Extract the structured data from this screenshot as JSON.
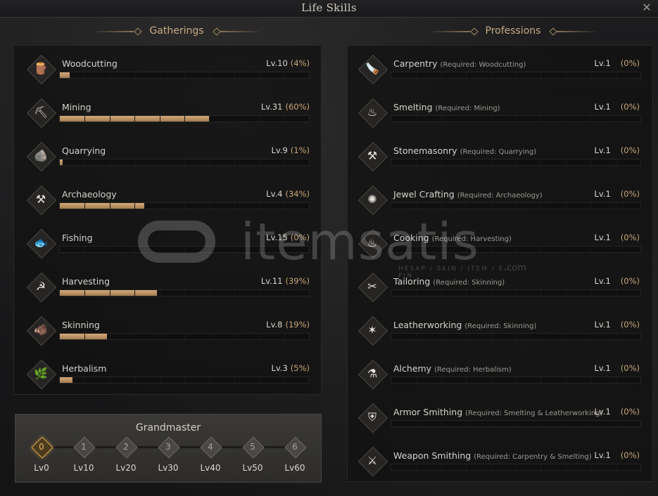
{
  "window": {
    "title": "Life Skills",
    "close_icon": "close-icon"
  },
  "gatherings": {
    "header": "Gatherings",
    "skills": [
      {
        "name": "Woodcutting",
        "level": "Lv.10",
        "percent": "(4%)",
        "progress": 0.04,
        "icon": "logs-icon",
        "glyph": "🪵"
      },
      {
        "name": "Mining",
        "level": "Lv.31",
        "percent": "(60%)",
        "progress": 0.6,
        "icon": "pickaxe-icon",
        "glyph": "⛏"
      },
      {
        "name": "Quarrying",
        "level": "Lv.9",
        "percent": "(1%)",
        "progress": 0.01,
        "icon": "stone-icon",
        "glyph": "🪨"
      },
      {
        "name": "Archaeology",
        "level": "Lv.4",
        "percent": "(34%)",
        "progress": 0.34,
        "icon": "shovel-icon",
        "glyph": "⚒"
      },
      {
        "name": "Fishing",
        "level": "Lv.15",
        "percent": "(0%)",
        "progress": 0.0,
        "icon": "fish-icon",
        "glyph": "🐟"
      },
      {
        "name": "Harvesting",
        "level": "Lv.11",
        "percent": "(39%)",
        "progress": 0.39,
        "icon": "sickle-icon",
        "glyph": "☭"
      },
      {
        "name": "Skinning",
        "level": "Lv.8",
        "percent": "(19%)",
        "progress": 0.19,
        "icon": "boar-icon",
        "glyph": "🐗"
      },
      {
        "name": "Herbalism",
        "level": "Lv.3",
        "percent": "(5%)",
        "progress": 0.05,
        "icon": "leaf-icon",
        "glyph": "🌿"
      }
    ]
  },
  "professions": {
    "header": "Professions",
    "skills": [
      {
        "name": "Carpentry",
        "req": "(Required: Woodcutting)",
        "level": "Lv.1",
        "percent": "(0%)",
        "icon": "saw-icon",
        "glyph": "🪚"
      },
      {
        "name": "Smelting",
        "req": "(Required: Mining)",
        "level": "Lv.1",
        "percent": "(0%)",
        "icon": "furnace-icon",
        "glyph": "♨"
      },
      {
        "name": "Stonemasonry",
        "req": "(Required: Quarrying)",
        "level": "Lv.1",
        "percent": "(0%)",
        "icon": "chisel-icon",
        "glyph": "⚒"
      },
      {
        "name": "Jewel Crafting",
        "req": "(Required: Archaeology)",
        "level": "Lv.1",
        "percent": "(0%)",
        "icon": "gem-icon",
        "glyph": "✺"
      },
      {
        "name": "Cooking",
        "req": "(Required: Harvesting)",
        "level": "Lv.1",
        "percent": "(0%)",
        "icon": "cauldron-icon",
        "glyph": "♨"
      },
      {
        "name": "Tailoring",
        "req": "(Required: Skinning)",
        "level": "Lv.1",
        "percent": "(0%)",
        "icon": "needle-icon",
        "glyph": "✂"
      },
      {
        "name": "Leatherworking",
        "req": "(Required: Skinning)",
        "level": "Lv.1",
        "percent": "(0%)",
        "icon": "hide-icon",
        "glyph": "✶"
      },
      {
        "name": "Alchemy",
        "req": "(Required: Herbalism)",
        "level": "Lv.1",
        "percent": "(0%)",
        "icon": "mortar-icon",
        "glyph": "⚗"
      },
      {
        "name": "Armor Smithing",
        "req": "(Required: Smelting & Leatherworking)",
        "level": "Lv.1",
        "percent": "(0%)",
        "icon": "armor-icon",
        "glyph": "⛨"
      },
      {
        "name": "Weapon Smithing",
        "req": "(Required: Carpentry & Smelting)",
        "level": "Lv.1",
        "percent": "(0%)",
        "icon": "sword-icon",
        "glyph": "⚔"
      }
    ]
  },
  "grandmaster": {
    "title": "Grandmaster",
    "tiers": [
      {
        "num": "0",
        "label": "Lv0",
        "active": true
      },
      {
        "num": "1",
        "label": "Lv10",
        "active": false
      },
      {
        "num": "2",
        "label": "Lv20",
        "active": false
      },
      {
        "num": "3",
        "label": "Lv30",
        "active": false
      },
      {
        "num": "4",
        "label": "Lv40",
        "active": false
      },
      {
        "num": "5",
        "label": "Lv50",
        "active": false
      },
      {
        "num": "6",
        "label": "Lv60",
        "active": false
      }
    ]
  },
  "watermark": {
    "brand": "itemsatis",
    "tagline": "HESAP / SKIN / ITEM / E-PIN",
    "suffix": ".com"
  }
}
